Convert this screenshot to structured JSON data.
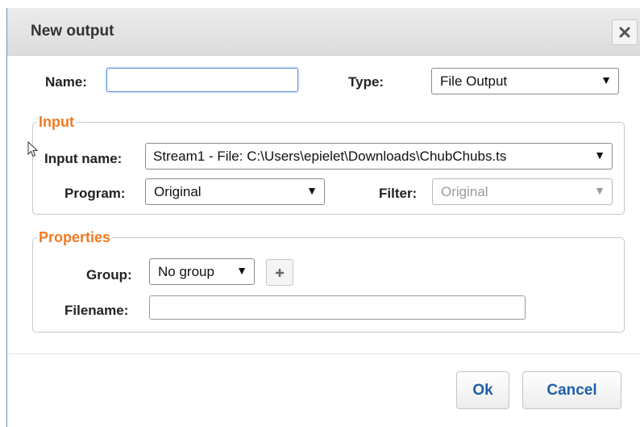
{
  "dialog": {
    "title": "New output",
    "close_icon": "close-x-icon"
  },
  "name_field": {
    "label": "Name:",
    "value": ""
  },
  "type_field": {
    "label": "Type:",
    "selected": "File Output"
  },
  "input_section": {
    "legend": "Input",
    "input_name_label": "Input name:",
    "input_name_selected": "Stream1 - File: C:\\Users\\epielet\\Downloads\\ChubChubs.ts",
    "program_label": "Program:",
    "program_selected": "Original",
    "filter_label": "Filter:",
    "filter_selected": "Original"
  },
  "properties_section": {
    "legend": "Properties",
    "group_label": "Group:",
    "group_selected": "No group",
    "add_group_icon": "plus-icon",
    "filename_label": "Filename:",
    "filename_value": ""
  },
  "footer": {
    "ok_label": "Ok",
    "cancel_label": "Cancel"
  },
  "dropdown_arrow": "▼",
  "colors": {
    "legend": "#f07a22",
    "button_text": "#1f5fa9",
    "focus": "#5b8fd6"
  }
}
